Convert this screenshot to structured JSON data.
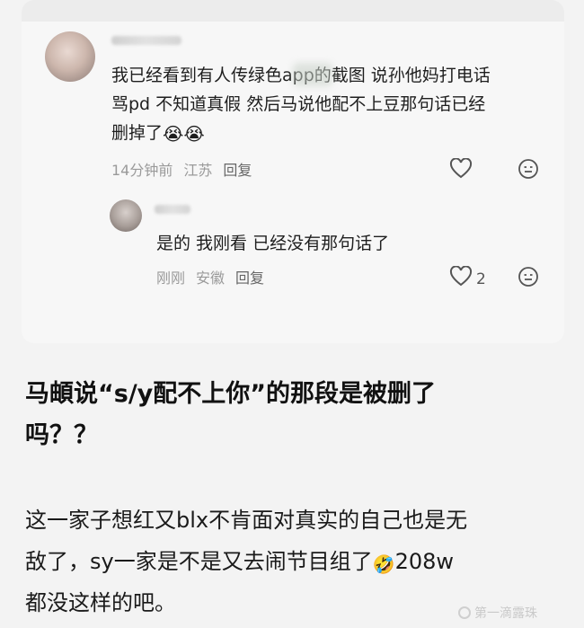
{
  "comment": {
    "username_obscured": true,
    "text_line1": "我已经看到有人传绿色app的截图 说孙他妈打电话",
    "text_line2": "骂pd  不知道真假 然后马说他配不上豆那句话已经",
    "text_line3": "删掉了",
    "emoji": "😭😭",
    "time": "14分钟前",
    "location": "江苏",
    "reply_label": "回复",
    "like_icon": "heart-icon",
    "react_icon": "smiley-icon"
  },
  "reply": {
    "text": "是的  我刚看  已经没有那句话了",
    "time": "刚刚",
    "location": "安徽",
    "reply_label": "回复",
    "like_count": "2"
  },
  "post": {
    "headline_line1": "马頔说“s/y配不上你”的那段是被删了",
    "headline_line2": "吗？？",
    "body_line1": "这一家子想红又blx不肯面对真实的自己也是无",
    "body_line2_a": "敌了，sy一家是不是又去闹节目组了",
    "body_emoji": "🤣",
    "body_line2_b": "208w",
    "body_line3": "都没这样的吧。"
  },
  "watermark": {
    "text": "第一滴露珠"
  }
}
